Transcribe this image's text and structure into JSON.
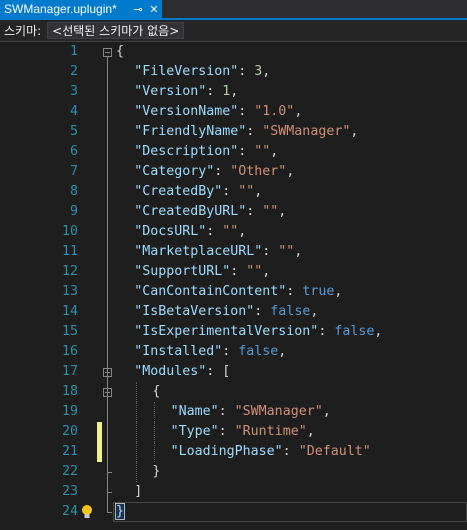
{
  "tab": {
    "title": "SWManager.uplugin*",
    "pin_glyph": "⊸",
    "close_glyph": "✕"
  },
  "schema": {
    "label": "스키마:",
    "value": "<선택된 스키마가 없음>"
  },
  "editor": {
    "line_numbers": [
      "1",
      "2",
      "3",
      "4",
      "5",
      "6",
      "7",
      "8",
      "9",
      "10",
      "11",
      "12",
      "13",
      "14",
      "15",
      "16",
      "17",
      "18",
      "19",
      "20",
      "21",
      "22",
      "23",
      "24"
    ],
    "lines": [
      {
        "indent": 0,
        "tokens": [
          {
            "t": "{",
            "c": "p"
          }
        ]
      },
      {
        "indent": 1,
        "tokens": [
          {
            "t": "\"FileVersion\"",
            "c": "k"
          },
          {
            "t": ": ",
            "c": "p"
          },
          {
            "t": "3",
            "c": "n"
          },
          {
            "t": ",",
            "c": "p"
          }
        ]
      },
      {
        "indent": 1,
        "tokens": [
          {
            "t": "\"Version\"",
            "c": "k"
          },
          {
            "t": ": ",
            "c": "p"
          },
          {
            "t": "1",
            "c": "n"
          },
          {
            "t": ",",
            "c": "p"
          }
        ]
      },
      {
        "indent": 1,
        "tokens": [
          {
            "t": "\"VersionName\"",
            "c": "k"
          },
          {
            "t": ": ",
            "c": "p"
          },
          {
            "t": "\"1.0\"",
            "c": "s"
          },
          {
            "t": ",",
            "c": "p"
          }
        ]
      },
      {
        "indent": 1,
        "tokens": [
          {
            "t": "\"FriendlyName\"",
            "c": "k"
          },
          {
            "t": ": ",
            "c": "p"
          },
          {
            "t": "\"SWManager\"",
            "c": "s"
          },
          {
            "t": ",",
            "c": "p"
          }
        ]
      },
      {
        "indent": 1,
        "tokens": [
          {
            "t": "\"Description\"",
            "c": "k"
          },
          {
            "t": ": ",
            "c": "p"
          },
          {
            "t": "\"\"",
            "c": "s"
          },
          {
            "t": ",",
            "c": "p"
          }
        ]
      },
      {
        "indent": 1,
        "tokens": [
          {
            "t": "\"Category\"",
            "c": "k"
          },
          {
            "t": ": ",
            "c": "p"
          },
          {
            "t": "\"Other\"",
            "c": "s"
          },
          {
            "t": ",",
            "c": "p"
          }
        ]
      },
      {
        "indent": 1,
        "tokens": [
          {
            "t": "\"CreatedBy\"",
            "c": "k"
          },
          {
            "t": ": ",
            "c": "p"
          },
          {
            "t": "\"\"",
            "c": "s"
          },
          {
            "t": ",",
            "c": "p"
          }
        ]
      },
      {
        "indent": 1,
        "tokens": [
          {
            "t": "\"CreatedByURL\"",
            "c": "k"
          },
          {
            "t": ": ",
            "c": "p"
          },
          {
            "t": "\"\"",
            "c": "s"
          },
          {
            "t": ",",
            "c": "p"
          }
        ]
      },
      {
        "indent": 1,
        "tokens": [
          {
            "t": "\"DocsURL\"",
            "c": "k"
          },
          {
            "t": ": ",
            "c": "p"
          },
          {
            "t": "\"\"",
            "c": "s"
          },
          {
            "t": ",",
            "c": "p"
          }
        ]
      },
      {
        "indent": 1,
        "tokens": [
          {
            "t": "\"MarketplaceURL\"",
            "c": "k"
          },
          {
            "t": ": ",
            "c": "p"
          },
          {
            "t": "\"\"",
            "c": "s"
          },
          {
            "t": ",",
            "c": "p"
          }
        ]
      },
      {
        "indent": 1,
        "tokens": [
          {
            "t": "\"SupportURL\"",
            "c": "k"
          },
          {
            "t": ": ",
            "c": "p"
          },
          {
            "t": "\"\"",
            "c": "s"
          },
          {
            "t": ",",
            "c": "p"
          }
        ]
      },
      {
        "indent": 1,
        "tokens": [
          {
            "t": "\"CanContainContent\"",
            "c": "k"
          },
          {
            "t": ": ",
            "c": "p"
          },
          {
            "t": "true",
            "c": "b"
          },
          {
            "t": ",",
            "c": "p"
          }
        ]
      },
      {
        "indent": 1,
        "tokens": [
          {
            "t": "\"IsBetaVersion\"",
            "c": "k"
          },
          {
            "t": ": ",
            "c": "p"
          },
          {
            "t": "false",
            "c": "b"
          },
          {
            "t": ",",
            "c": "p"
          }
        ]
      },
      {
        "indent": 1,
        "tokens": [
          {
            "t": "\"IsExperimentalVersion\"",
            "c": "k"
          },
          {
            "t": ": ",
            "c": "p"
          },
          {
            "t": "false",
            "c": "b"
          },
          {
            "t": ",",
            "c": "p"
          }
        ]
      },
      {
        "indent": 1,
        "tokens": [
          {
            "t": "\"Installed\"",
            "c": "k"
          },
          {
            "t": ": ",
            "c": "p"
          },
          {
            "t": "false",
            "c": "b"
          },
          {
            "t": ",",
            "c": "p"
          }
        ]
      },
      {
        "indent": 1,
        "tokens": [
          {
            "t": "\"Modules\"",
            "c": "k"
          },
          {
            "t": ": [",
            "c": "p"
          }
        ]
      },
      {
        "indent": 2,
        "tokens": [
          {
            "t": "{",
            "c": "p"
          }
        ]
      },
      {
        "indent": 3,
        "tokens": [
          {
            "t": "\"Name\"",
            "c": "k"
          },
          {
            "t": ": ",
            "c": "p"
          },
          {
            "t": "\"SWManager\"",
            "c": "s"
          },
          {
            "t": ",",
            "c": "p"
          }
        ]
      },
      {
        "indent": 3,
        "tokens": [
          {
            "t": "\"Type\"",
            "c": "k"
          },
          {
            "t": ": ",
            "c": "p"
          },
          {
            "t": "\"Runtime\"",
            "c": "s"
          },
          {
            "t": ",",
            "c": "p"
          }
        ]
      },
      {
        "indent": 3,
        "tokens": [
          {
            "t": "\"LoadingPhase\"",
            "c": "k"
          },
          {
            "t": ": ",
            "c": "p"
          },
          {
            "t": "\"Default\"",
            "c": "s"
          }
        ]
      },
      {
        "indent": 2,
        "tokens": [
          {
            "t": "}",
            "c": "p"
          }
        ]
      },
      {
        "indent": 1,
        "tokens": [
          {
            "t": "]",
            "c": "p"
          }
        ]
      },
      {
        "indent": 0,
        "tokens": [
          {
            "t": "}",
            "c": "p"
          }
        ]
      }
    ],
    "modified_lines": [
      20,
      21
    ],
    "current_line": 24,
    "lightbulb_line": 24,
    "colors": {
      "background": "#1e1e1e",
      "line_number": "#2b91af",
      "property_key": "#9cdcfe",
      "string": "#ce9178",
      "number": "#b5cea8",
      "keyword": "#569cd6",
      "punctuation": "#d4d4d4",
      "change_marker": "#efef91",
      "tab_active": "#007acc"
    }
  }
}
